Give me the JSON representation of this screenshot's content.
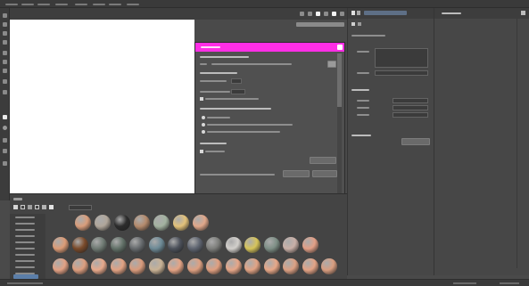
{
  "app": {
    "title": ""
  },
  "menubar": {
    "items": [
      "",
      "",
      "",
      "",
      "",
      "",
      "",
      ""
    ]
  },
  "viewport": {
    "header_label": ""
  },
  "dialog": {
    "title": "",
    "sections": [
      {
        "heading": "",
        "rows": [
          "",
          ""
        ]
      },
      {
        "heading": "",
        "rows": [
          "",
          "",
          ""
        ]
      },
      {
        "heading": "",
        "rows": [
          "",
          ""
        ]
      }
    ],
    "buttons": {
      "primary": "",
      "secondary": ""
    }
  },
  "right_panel_a": {
    "active_tab": "",
    "section_heading": ""
  },
  "right_panel_b": {
    "title": ""
  },
  "library": {
    "tab_label": "",
    "tree_items": [
      "",
      "",
      "",
      "",
      "",
      "",
      "",
      "",
      "",
      "",
      ""
    ],
    "rows": [
      [
        "#d99d7b",
        "#b0a69a",
        "#2c2c2c",
        "#b48a6c",
        "#a3b2a0",
        "#e3c27a",
        "#e0a78a"
      ],
      [
        "#dc9b76",
        "#7a4a2a",
        "#6f7a73",
        "#627168",
        "#666a6d",
        "#6d8a96",
        "#4c515b",
        "#5e6470",
        "#7d7e7b",
        "#d2cfcb",
        "#d6c45a",
        "#7e8f86",
        "#c9b0a7",
        "#e29f86"
      ],
      [
        "#e3a184",
        "#dd9e7f",
        "#e8a98b",
        "#e2a283",
        "#d99b7c",
        "#c9b295",
        "#e5a485",
        "#dea081",
        "#e09f80",
        "#e6a688",
        "#e1a384",
        "#e7a787",
        "#dca083",
        "#e3a385",
        "#d99e80"
      ]
    ]
  },
  "status": {
    "left": "",
    "right": ""
  }
}
